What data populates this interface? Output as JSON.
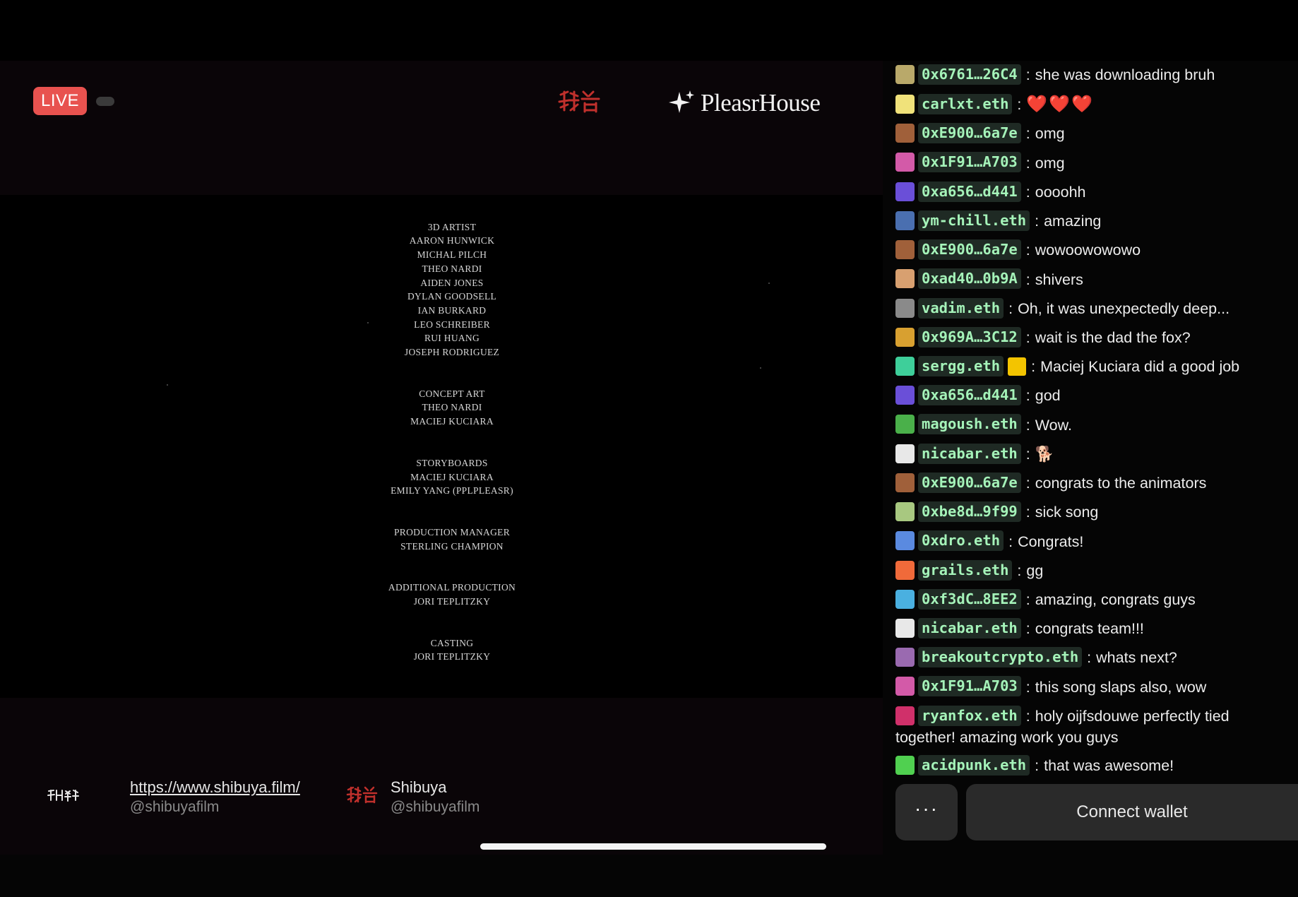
{
  "stream": {
    "live_label": "LIVE",
    "brand_name": "PleasrHouse"
  },
  "credits": [
    {
      "lines": [
        "3D ARTIST",
        "AARON HUNWICK",
        "MICHAL PILCH",
        "THEO NARDI",
        "AIDEN JONES",
        "DYLAN GOODSELL",
        "IAN BURKARD",
        "LEO SCHREIBER",
        "RUI HUANG",
        "JOSEPH RODRIGUEZ"
      ]
    },
    {
      "lines": [
        "CONCEPT ART",
        "THEO NARDI",
        "MACIEJ KUCIARA"
      ]
    },
    {
      "lines": [
        "STORYBOARDS",
        "MACIEJ KUCIARA",
        "EMILY YANG (PPLPLEASR)"
      ]
    },
    {
      "lines": [
        "PRODUCTION MANAGER",
        "STERLING CHAMPION"
      ]
    },
    {
      "lines": [
        "ADDITIONAL PRODUCTION",
        "JORI TEPLITZKY"
      ]
    },
    {
      "lines": [
        "CASTING",
        "JORI TEPLITZKY"
      ]
    }
  ],
  "footer": {
    "film_url": "https://www.shibuya.film/",
    "film_handle": "@shibuyafilm",
    "channel_name": "Shibuya",
    "channel_handle": "@shibuyafilm"
  },
  "chat": {
    "messages": [
      {
        "user": "0x6761…26C4",
        "text": "she was downloading bruh",
        "avatar_color": "#b9a96a"
      },
      {
        "user": "carlxt.eth",
        "text": "❤️❤️❤️",
        "avatar_color": "#f0e27a"
      },
      {
        "user": "0xE900…6a7e",
        "text": "omg",
        "avatar_color": "#a0603a"
      },
      {
        "user": "0x1F91…A703",
        "text": "omg",
        "avatar_color": "#d35aa8"
      },
      {
        "user": "0xa656…d441",
        "text": "oooohh",
        "avatar_color": "#6a4fd8"
      },
      {
        "user": "ym-chill.eth",
        "text": "amazing",
        "avatar_color": "#4a6fb0"
      },
      {
        "user": "0xE900…6a7e",
        "text": "wowoowowowo",
        "avatar_color": "#a0603a"
      },
      {
        "user": "0xad40…0b9A",
        "text": "shivers",
        "avatar_color": "#d8a070"
      },
      {
        "user": "vadim.eth",
        "text": "Oh, it was unexpectedly deep...",
        "avatar_color": "#8a8a8a"
      },
      {
        "user": "0x969A…3C12",
        "text": "wait is the dad the fox?",
        "avatar_color": "#d8a030"
      },
      {
        "user": "sergg.eth",
        "text": "Maciej Kuciara did a good job",
        "avatar_color": "#3ecf9a"
      },
      {
        "user": "0xa656…d441",
        "text": "god",
        "avatar_color": "#6a4fd8"
      },
      {
        "user": "magoush.eth",
        "text": "Wow.",
        "avatar_color": "#4ab04a"
      },
      {
        "user": "nicabar.eth",
        "text": "🐕",
        "avatar_color": "#e8e8e8"
      },
      {
        "user": "0xE900…6a7e",
        "text": "congrats to the animators",
        "avatar_color": "#a0603a"
      },
      {
        "user": "0xbe8d…9f99",
        "text": "sick song",
        "avatar_color": "#a8c880"
      },
      {
        "user": "0xdro.eth",
        "text": "Congrats!",
        "avatar_color": "#5a8ae0"
      },
      {
        "user": "grails.eth",
        "text": "gg",
        "avatar_color": "#f06a3a"
      },
      {
        "user": "0xf3dC…8EE2",
        "text": "amazing, congrats guys",
        "avatar_color": "#4ab0e0"
      },
      {
        "user": "nicabar.eth",
        "text": "congrats team!!!",
        "avatar_color": "#e8e8e8"
      },
      {
        "user": "breakoutcrypto.eth",
        "text": "whats next?",
        "avatar_color": "#9a6ab0"
      },
      {
        "user": "0x1F91…A703",
        "text": "this song slaps also, wow",
        "avatar_color": "#d35aa8"
      },
      {
        "user": "ryanfox.eth",
        "text": "holy oijfsdouwe perfectly tied together! amazing work you guys",
        "avatar_color": "#d0306a"
      },
      {
        "user": "acidpunk.eth",
        "text": "that was awesome!",
        "avatar_color": "#50d050"
      }
    ]
  },
  "actions": {
    "more_label": "···",
    "connect_label": "Connect wallet"
  }
}
